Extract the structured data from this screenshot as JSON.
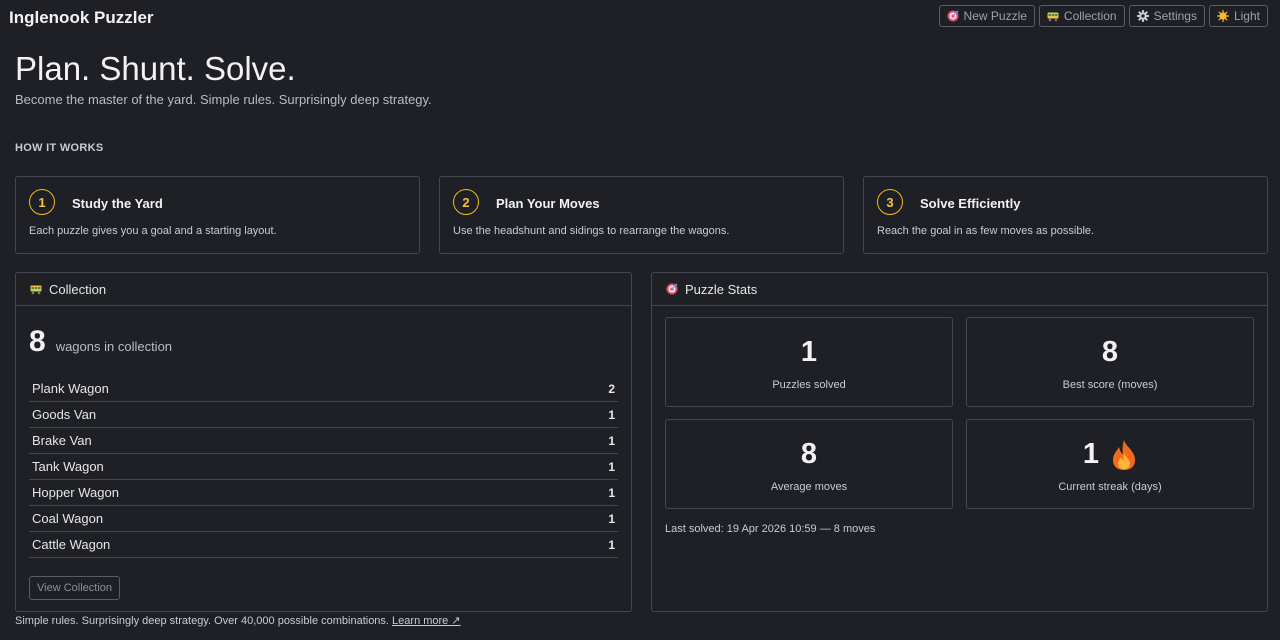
{
  "app": {
    "title": "Inglenook Puzzler"
  },
  "nav": {
    "new_puzzle": {
      "label": "New Puzzle",
      "icon": "target-icon"
    },
    "collection": {
      "label": "Collection",
      "icon": "wagon-icon"
    },
    "settings": {
      "label": "Settings",
      "icon": "gear-icon"
    },
    "theme": {
      "label": "Light",
      "icon": "sun-icon"
    }
  },
  "hero": {
    "title": "Plan. Shunt. Solve.",
    "subtitle": "Become the master of the yard. Simple rules. Surprisingly deep strategy."
  },
  "how_it_works": {
    "label": "HOW IT WORKS",
    "steps": [
      {
        "num": "1",
        "title": "Study the Yard",
        "desc": "Each puzzle gives you a goal and a starting layout."
      },
      {
        "num": "2",
        "title": "Plan Your Moves",
        "desc": "Use the headshunt and sidings to rearrange the wagons."
      },
      {
        "num": "3",
        "title": "Solve Efficiently",
        "desc": "Reach the goal in as few moves as possible."
      }
    ]
  },
  "collection": {
    "title": "Collection",
    "count": "8",
    "count_label": "wagons in collection",
    "wagons": [
      {
        "name": "Plank Wagon",
        "qty": "2"
      },
      {
        "name": "Goods Van",
        "qty": "1"
      },
      {
        "name": "Brake Van",
        "qty": "1"
      },
      {
        "name": "Tank Wagon",
        "qty": "1"
      },
      {
        "name": "Hopper Wagon",
        "qty": "1"
      },
      {
        "name": "Coal Wagon",
        "qty": "1"
      },
      {
        "name": "Cattle Wagon",
        "qty": "1"
      }
    ],
    "view_button": "View Collection"
  },
  "stats": {
    "title": "Puzzle Stats",
    "solved": {
      "value": "1",
      "label": "Puzzles solved"
    },
    "best": {
      "value": "8",
      "label": "Best score (moves)"
    },
    "average": {
      "value": "8",
      "label": "Average moves"
    },
    "streak": {
      "value": "1",
      "label": "Current streak (days)",
      "icon": "fire-icon"
    },
    "last_solved": "Last solved: 19 Apr 2026 10:59 — 8 moves"
  },
  "footer": {
    "text": "Simple rules. Surprisingly deep strategy. Over 40,000 possible combinations.",
    "link": "Learn more ↗"
  },
  "colors": {
    "background": "#1e2026",
    "border": "#44474f",
    "accent": "#f1b81c"
  }
}
